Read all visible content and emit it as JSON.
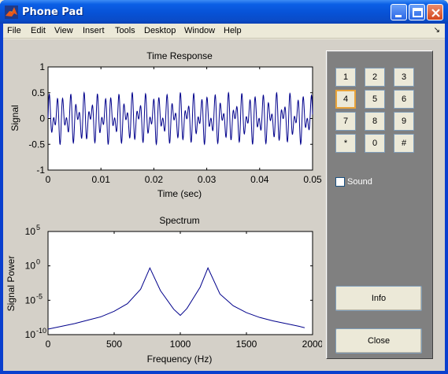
{
  "window": {
    "title": "Phone Pad"
  },
  "menu": {
    "items": [
      "File",
      "Edit",
      "View",
      "Insert",
      "Tools",
      "Desktop",
      "Window",
      "Help"
    ],
    "overflow_glyph": "↘"
  },
  "panel": {
    "keys": [
      "1",
      "2",
      "3",
      "4",
      "5",
      "6",
      "7",
      "8",
      "9",
      "*",
      "0",
      "#"
    ],
    "focused_key": "4",
    "sound_label": "Sound",
    "sound_checked": false,
    "info_label": "Info",
    "close_label": "Close"
  },
  "colors": {
    "titlebar": "#0752d6",
    "plot_line": "#00008b",
    "panel_bg": "#808080"
  },
  "chart_data": [
    {
      "type": "line",
      "title": "Time Response",
      "xlabel": "Time (sec)",
      "ylabel": "Signal",
      "xlim": [
        0,
        0.05
      ],
      "ylim": [
        -1,
        1
      ],
      "xticks": [
        "0",
        "0.01",
        "0.02",
        "0.03",
        "0.04",
        "0.05"
      ],
      "yticks": [
        "-1",
        "-0.5",
        "0",
        "0.5",
        "1"
      ],
      "series": [
        {
          "description": "sum of two sinusoids, 770 Hz and 1209 Hz (DTMF key 4), amplitude ±0.5",
          "frequencies_hz": [
            770,
            1209
          ],
          "amplitude": 0.25
        }
      ]
    },
    {
      "type": "line",
      "title": "Spectrum",
      "xlabel": "Frequency (Hz)",
      "ylabel": "Signal Power",
      "xlim": [
        0,
        2000
      ],
      "ylim_log10": [
        -10,
        5
      ],
      "xticks": [
        "0",
        "500",
        "1000",
        "1500",
        "2000"
      ],
      "yticks": [
        "10^-10",
        "10^-5",
        "10^0",
        "10^5"
      ],
      "x": [
        0,
        100,
        200,
        300,
        400,
        500,
        600,
        700,
        770,
        850,
        950,
        1000,
        1050,
        1150,
        1209,
        1300,
        1400,
        1500,
        1600,
        1700,
        1800,
        1900,
        1940
      ],
      "log10_y": [
        -9.2,
        -8.8,
        -8.4,
        -7.9,
        -7.4,
        -6.6,
        -5.5,
        -3.4,
        -0.3,
        -3.6,
        -6.3,
        -7.2,
        -6.2,
        -3.1,
        -0.3,
        -4.1,
        -5.8,
        -6.8,
        -7.5,
        -8.0,
        -8.4,
        -8.8,
        -9.0
      ]
    }
  ]
}
